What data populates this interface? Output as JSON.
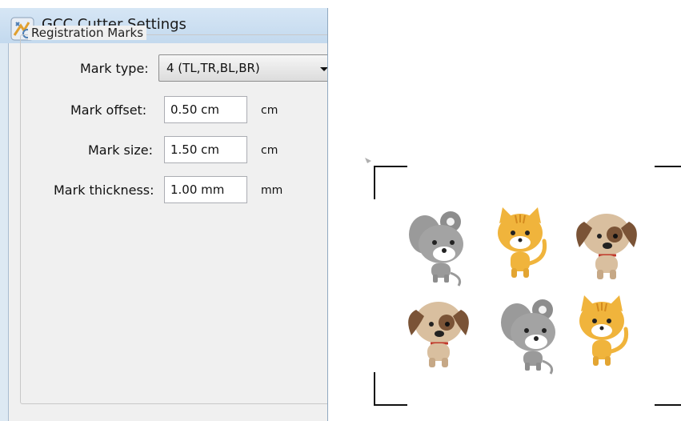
{
  "window": {
    "title": "GCC Cutter Settings",
    "icon": "gcc-app-icon"
  },
  "registration": {
    "group_title": "Registration Marks",
    "mark_type": {
      "label": "Mark type:",
      "value": "4 (TL,TR,BL,BR)"
    },
    "mark_offset": {
      "label": "Mark offset:",
      "value": "0.50 cm",
      "unit": "cm"
    },
    "mark_size": {
      "label": "Mark size:",
      "value": "1.50 cm",
      "unit": "cm"
    },
    "mark_thickness": {
      "label": "Mark thickness:",
      "value": "1.00 mm",
      "unit": "mm"
    }
  },
  "preview": {
    "marks": [
      "top-left",
      "top-right",
      "bottom-left",
      "bottom-right"
    ],
    "stickers": [
      "mouse",
      "cat",
      "dog",
      "dog",
      "mouse",
      "cat"
    ]
  },
  "colors": {
    "title_bar": "#c8dcf0",
    "dialog_bg": "#f0f0f0",
    "cat": "#f0b43c",
    "dog": "#c8a582",
    "mouse": "#9a9a9a"
  }
}
